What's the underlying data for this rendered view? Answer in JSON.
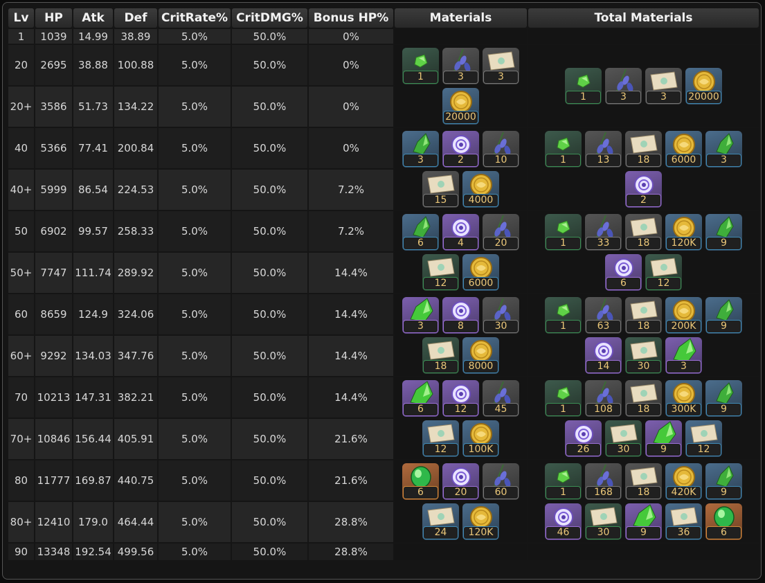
{
  "headers": [
    "Lv",
    "HP",
    "Atk",
    "Def",
    "CritRate%",
    "CritDMG%",
    "Bonus HP%",
    "Materials",
    "Total Materials"
  ],
  "rows": [
    {
      "lv": "1",
      "hp": "1039",
      "atk": "14.99",
      "def": "38.89",
      "cr": "5.0%",
      "cd": "50.0%",
      "bonus": "0%"
    },
    {
      "lv": "20",
      "hp": "2695",
      "atk": "38.88",
      "def": "100.88",
      "cr": "5.0%",
      "cd": "50.0%",
      "bonus": "0%"
    },
    {
      "lv": "20+",
      "hp": "3586",
      "atk": "51.73",
      "def": "134.22",
      "cr": "5.0%",
      "cd": "50.0%",
      "bonus": "0%"
    },
    {
      "lv": "40",
      "hp": "5366",
      "atk": "77.41",
      "def": "200.84",
      "cr": "5.0%",
      "cd": "50.0%",
      "bonus": "0%"
    },
    {
      "lv": "40+",
      "hp": "5999",
      "atk": "86.54",
      "def": "224.53",
      "cr": "5.0%",
      "cd": "50.0%",
      "bonus": "7.2%"
    },
    {
      "lv": "50",
      "hp": "6902",
      "atk": "99.57",
      "def": "258.33",
      "cr": "5.0%",
      "cd": "50.0%",
      "bonus": "7.2%"
    },
    {
      "lv": "50+",
      "hp": "7747",
      "atk": "111.74",
      "def": "289.92",
      "cr": "5.0%",
      "cd": "50.0%",
      "bonus": "14.4%"
    },
    {
      "lv": "60",
      "hp": "8659",
      "atk": "124.9",
      "def": "324.06",
      "cr": "5.0%",
      "cd": "50.0%",
      "bonus": "14.4%"
    },
    {
      "lv": "60+",
      "hp": "9292",
      "atk": "134.03",
      "def": "347.76",
      "cr": "5.0%",
      "cd": "50.0%",
      "bonus": "14.4%"
    },
    {
      "lv": "70",
      "hp": "10213",
      "atk": "147.31",
      "def": "382.21",
      "cr": "5.0%",
      "cd": "50.0%",
      "bonus": "14.4%"
    },
    {
      "lv": "70+",
      "hp": "10846",
      "atk": "156.44",
      "def": "405.91",
      "cr": "5.0%",
      "cd": "50.0%",
      "bonus": "21.6%"
    },
    {
      "lv": "80",
      "hp": "11777",
      "atk": "169.87",
      "def": "440.75",
      "cr": "5.0%",
      "cd": "50.0%",
      "bonus": "21.6%"
    },
    {
      "lv": "80+",
      "hp": "12410",
      "atk": "179.0",
      "def": "464.44",
      "cr": "5.0%",
      "cd": "50.0%",
      "bonus": "28.8%"
    },
    {
      "lv": "90",
      "hp": "13348",
      "atk": "192.54",
      "def": "499.56",
      "cr": "5.0%",
      "cd": "50.0%",
      "bonus": "28.8%"
    }
  ],
  "materials": [
    [
      {
        "icon": "jade-sliver-gem-icon",
        "rarity": 2,
        "qty": "1"
      },
      {
        "icon": "specialty-flower-icon",
        "rarity": 1,
        "qty": "3"
      },
      {
        "icon": "scroll-icon",
        "rarity": 1,
        "qty": "3"
      },
      {
        "icon": "mora-coin-icon",
        "rarity": 3,
        "qty": "20000"
      }
    ],
    [
      {
        "icon": "jade-fragment-gem-icon",
        "rarity": 3,
        "qty": "3"
      },
      {
        "icon": "boss-core-icon",
        "rarity": 4,
        "qty": "2"
      },
      {
        "icon": "specialty-flower-icon",
        "rarity": 1,
        "qty": "10"
      },
      {
        "icon": "scroll-icon",
        "rarity": 1,
        "qty": "15"
      },
      {
        "icon": "mora-coin-icon",
        "rarity": 3,
        "qty": "4000"
      }
    ],
    [
      {
        "icon": "jade-fragment-gem-icon",
        "rarity": 3,
        "qty": "6"
      },
      {
        "icon": "boss-core-icon",
        "rarity": 4,
        "qty": "4"
      },
      {
        "icon": "specialty-flower-icon",
        "rarity": 1,
        "qty": "20"
      },
      {
        "icon": "scroll-icon",
        "rarity": 2,
        "qty": "12"
      },
      {
        "icon": "mora-coin-icon",
        "rarity": 3,
        "qty": "6000"
      }
    ],
    [
      {
        "icon": "jade-chunk-gem-icon",
        "rarity": 4,
        "qty": "3"
      },
      {
        "icon": "boss-core-icon",
        "rarity": 4,
        "qty": "8"
      },
      {
        "icon": "specialty-flower-icon",
        "rarity": 1,
        "qty": "30"
      },
      {
        "icon": "scroll-icon",
        "rarity": 2,
        "qty": "18"
      },
      {
        "icon": "mora-coin-icon",
        "rarity": 3,
        "qty": "8000"
      }
    ],
    [
      {
        "icon": "jade-chunk-gem-icon",
        "rarity": 4,
        "qty": "6"
      },
      {
        "icon": "boss-core-icon",
        "rarity": 4,
        "qty": "12"
      },
      {
        "icon": "specialty-flower-icon",
        "rarity": 1,
        "qty": "45"
      },
      {
        "icon": "scroll-icon",
        "rarity": 3,
        "qty": "12"
      },
      {
        "icon": "mora-coin-icon",
        "rarity": 3,
        "qty": "100K"
      }
    ],
    [
      {
        "icon": "jade-gemstone-icon",
        "rarity": 5,
        "qty": "6"
      },
      {
        "icon": "boss-core-icon",
        "rarity": 4,
        "qty": "20"
      },
      {
        "icon": "specialty-flower-icon",
        "rarity": 1,
        "qty": "60"
      },
      {
        "icon": "scroll-icon",
        "rarity": 3,
        "qty": "24"
      },
      {
        "icon": "mora-coin-icon",
        "rarity": 3,
        "qty": "120K"
      }
    ]
  ],
  "total_materials": [
    [
      {
        "icon": "jade-sliver-gem-icon",
        "rarity": 2,
        "qty": "1"
      },
      {
        "icon": "specialty-flower-icon",
        "rarity": 1,
        "qty": "3"
      },
      {
        "icon": "scroll-icon",
        "rarity": 1,
        "qty": "3"
      },
      {
        "icon": "mora-coin-icon",
        "rarity": 3,
        "qty": "20000"
      }
    ],
    [
      {
        "icon": "jade-sliver-gem-icon",
        "rarity": 2,
        "qty": "1"
      },
      {
        "icon": "specialty-flower-icon",
        "rarity": 1,
        "qty": "13"
      },
      {
        "icon": "scroll-icon",
        "rarity": 1,
        "qty": "18"
      },
      {
        "icon": "mora-coin-icon",
        "rarity": 3,
        "qty": "6000"
      },
      {
        "icon": "jade-fragment-gem-icon",
        "rarity": 3,
        "qty": "3"
      },
      {
        "icon": "boss-core-icon",
        "rarity": 4,
        "qty": "2"
      }
    ],
    [
      {
        "icon": "jade-sliver-gem-icon",
        "rarity": 2,
        "qty": "1"
      },
      {
        "icon": "specialty-flower-icon",
        "rarity": 1,
        "qty": "33"
      },
      {
        "icon": "scroll-icon",
        "rarity": 1,
        "qty": "18"
      },
      {
        "icon": "mora-coin-icon",
        "rarity": 3,
        "qty": "120K"
      },
      {
        "icon": "jade-fragment-gem-icon",
        "rarity": 3,
        "qty": "9"
      },
      {
        "icon": "boss-core-icon",
        "rarity": 4,
        "qty": "6"
      },
      {
        "icon": "scroll-icon",
        "rarity": 2,
        "qty": "12"
      }
    ],
    [
      {
        "icon": "jade-sliver-gem-icon",
        "rarity": 2,
        "qty": "1"
      },
      {
        "icon": "specialty-flower-icon",
        "rarity": 1,
        "qty": "63"
      },
      {
        "icon": "scroll-icon",
        "rarity": 1,
        "qty": "18"
      },
      {
        "icon": "mora-coin-icon",
        "rarity": 3,
        "qty": "200K"
      },
      {
        "icon": "jade-fragment-gem-icon",
        "rarity": 3,
        "qty": "9"
      },
      {
        "icon": "boss-core-icon",
        "rarity": 4,
        "qty": "14"
      },
      {
        "icon": "scroll-icon",
        "rarity": 2,
        "qty": "30"
      },
      {
        "icon": "jade-chunk-gem-icon",
        "rarity": 4,
        "qty": "3"
      }
    ],
    [
      {
        "icon": "jade-sliver-gem-icon",
        "rarity": 2,
        "qty": "1"
      },
      {
        "icon": "specialty-flower-icon",
        "rarity": 1,
        "qty": "108"
      },
      {
        "icon": "scroll-icon",
        "rarity": 1,
        "qty": "18"
      },
      {
        "icon": "mora-coin-icon",
        "rarity": 3,
        "qty": "300K"
      },
      {
        "icon": "jade-fragment-gem-icon",
        "rarity": 3,
        "qty": "9"
      },
      {
        "icon": "boss-core-icon",
        "rarity": 4,
        "qty": "26"
      },
      {
        "icon": "scroll-icon",
        "rarity": 2,
        "qty": "30"
      },
      {
        "icon": "jade-chunk-gem-icon",
        "rarity": 4,
        "qty": "9"
      },
      {
        "icon": "scroll-icon",
        "rarity": 3,
        "qty": "12"
      }
    ],
    [
      {
        "icon": "jade-sliver-gem-icon",
        "rarity": 2,
        "qty": "1"
      },
      {
        "icon": "specialty-flower-icon",
        "rarity": 1,
        "qty": "168"
      },
      {
        "icon": "scroll-icon",
        "rarity": 1,
        "qty": "18"
      },
      {
        "icon": "mora-coin-icon",
        "rarity": 3,
        "qty": "420K"
      },
      {
        "icon": "jade-fragment-gem-icon",
        "rarity": 3,
        "qty": "9"
      },
      {
        "icon": "boss-core-icon",
        "rarity": 4,
        "qty": "46"
      },
      {
        "icon": "scroll-icon",
        "rarity": 2,
        "qty": "30"
      },
      {
        "icon": "jade-chunk-gem-icon",
        "rarity": 4,
        "qty": "9"
      },
      {
        "icon": "scroll-icon",
        "rarity": 3,
        "qty": "36"
      },
      {
        "icon": "jade-gemstone-icon",
        "rarity": 5,
        "qty": "6"
      }
    ]
  ]
}
